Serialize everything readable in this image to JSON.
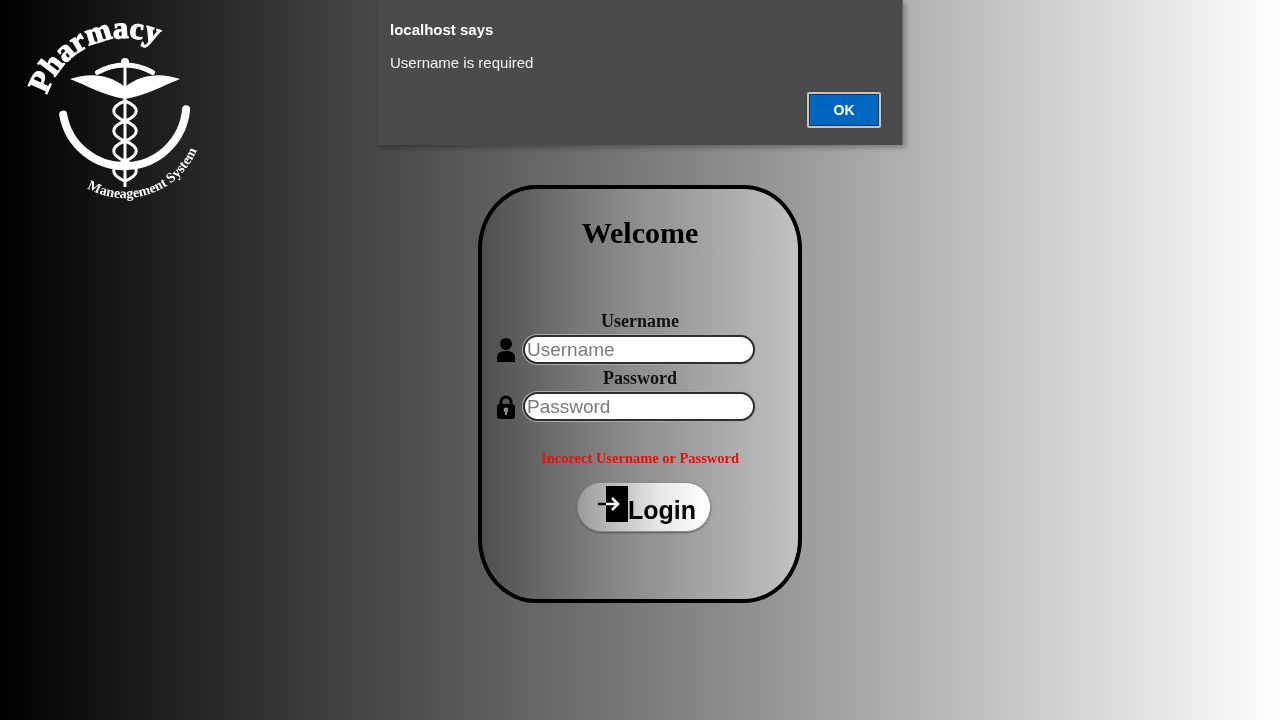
{
  "logo": {
    "title": "Pharmacy",
    "subtitle": "Maneagement System"
  },
  "dialog": {
    "title": "localhost says",
    "message": "Username is required",
    "button": "OK"
  },
  "login_card": {
    "title": "Welcome",
    "fields": [
      {
        "kind": "text",
        "label": "Username",
        "placeholder": "Username"
      },
      {
        "kind": "password",
        "label": "Password",
        "placeholder": "Password"
      }
    ],
    "error": "Incorect Username or Password",
    "submit": "Login"
  }
}
